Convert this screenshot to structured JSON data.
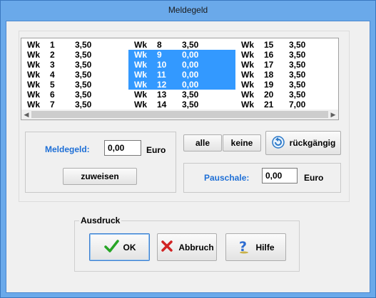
{
  "window": {
    "title": "Meldegeld"
  },
  "weeks": {
    "columns": [
      [
        {
          "wk": "Wk",
          "n": "1",
          "v": "3,50",
          "sel": false
        },
        {
          "wk": "Wk",
          "n": "2",
          "v": "3,50",
          "sel": false
        },
        {
          "wk": "Wk",
          "n": "3",
          "v": "3,50",
          "sel": false
        },
        {
          "wk": "Wk",
          "n": "4",
          "v": "3,50",
          "sel": false
        },
        {
          "wk": "Wk",
          "n": "5",
          "v": "3,50",
          "sel": false
        },
        {
          "wk": "Wk",
          "n": "6",
          "v": "3,50",
          "sel": false
        },
        {
          "wk": "Wk",
          "n": "7",
          "v": "3,50",
          "sel": false
        }
      ],
      [
        {
          "wk": "Wk",
          "n": "8",
          "v": "3,50",
          "sel": false
        },
        {
          "wk": "Wk",
          "n": "9",
          "v": "0,00",
          "sel": true
        },
        {
          "wk": "Wk",
          "n": "10",
          "v": "0,00",
          "sel": true
        },
        {
          "wk": "Wk",
          "n": "11",
          "v": "0,00",
          "sel": true
        },
        {
          "wk": "Wk",
          "n": "12",
          "v": "0,00",
          "sel": true
        },
        {
          "wk": "Wk",
          "n": "13",
          "v": "3,50",
          "sel": false
        },
        {
          "wk": "Wk",
          "n": "14",
          "v": "3,50",
          "sel": false
        }
      ],
      [
        {
          "wk": "Wk",
          "n": "15",
          "v": "3,50",
          "sel": false
        },
        {
          "wk": "Wk",
          "n": "16",
          "v": "3,50",
          "sel": false
        },
        {
          "wk": "Wk",
          "n": "17",
          "v": "3,50",
          "sel": false
        },
        {
          "wk": "Wk",
          "n": "18",
          "v": "3,50",
          "sel": false
        },
        {
          "wk": "Wk",
          "n": "19",
          "v": "3,50",
          "sel": false
        },
        {
          "wk": "Wk",
          "n": "20",
          "v": "3,50",
          "sel": false
        },
        {
          "wk": "Wk",
          "n": "21",
          "v": "7,00",
          "sel": false
        }
      ]
    ]
  },
  "meldegeld": {
    "label": "Meldegeld:",
    "value": "0,00",
    "unit": "Euro",
    "assign_label": "zuweisen"
  },
  "selection": {
    "all_label": "alle",
    "none_label": "keine",
    "undo_label": "rückgängig"
  },
  "pauschale": {
    "label": "Pauschale:",
    "value": "0,00",
    "unit": "Euro"
  },
  "print": {
    "group_label": "Ausdruck",
    "ok_label": "OK",
    "cancel_label": "Abbruch",
    "help_label": "Hilfe"
  },
  "colors": {
    "accent": "#1e6fd6",
    "selection": "#3399ff",
    "titlebar": "#6aa9ea"
  }
}
